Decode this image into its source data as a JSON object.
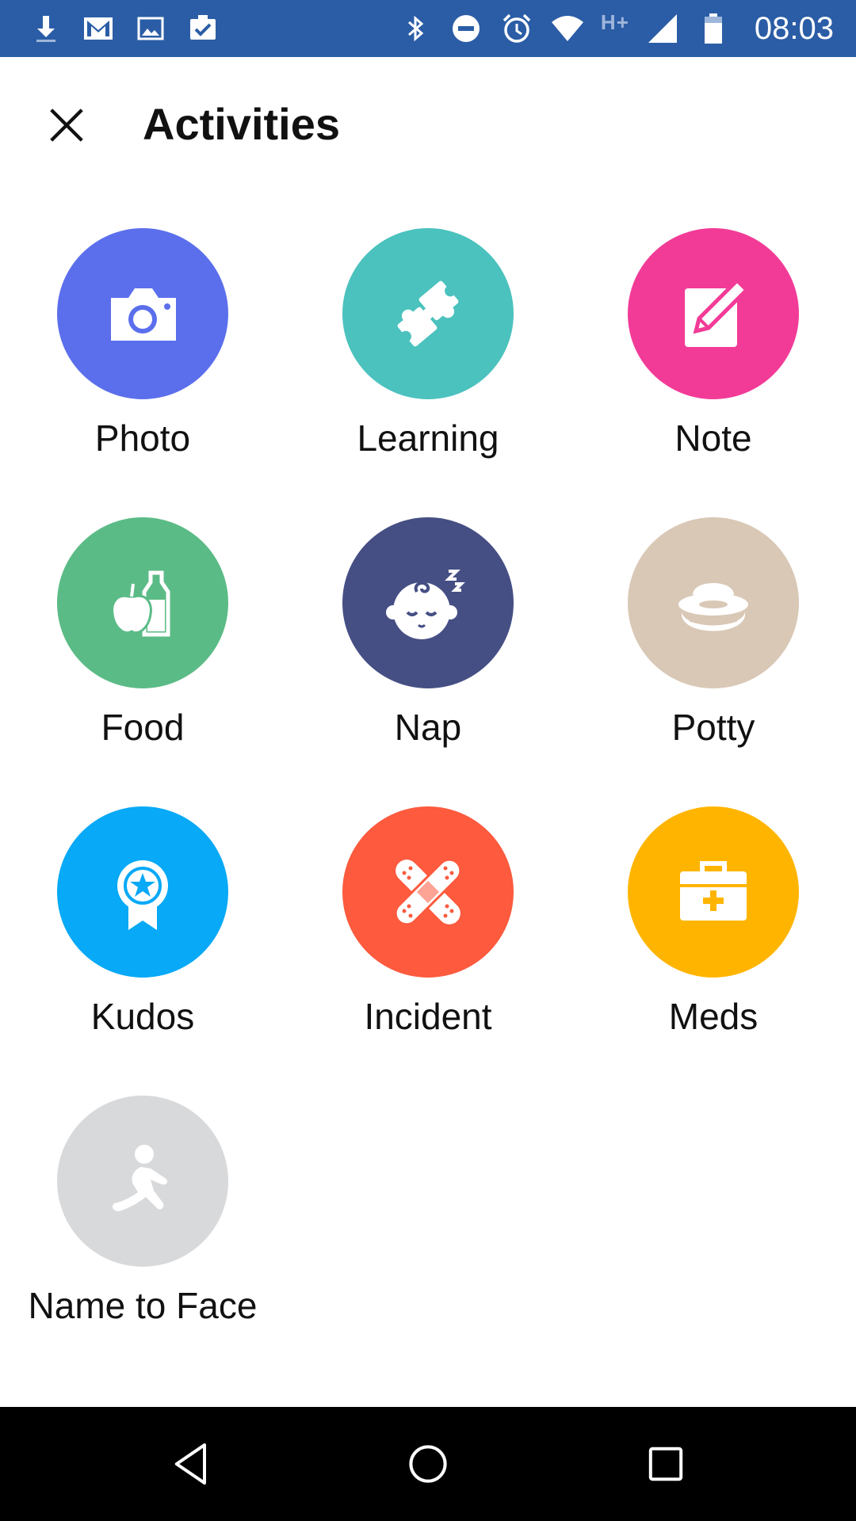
{
  "status_bar": {
    "time": "08:03",
    "network": "H+",
    "background": "#2b5da6",
    "left_icons": [
      "download-icon",
      "gmail-icon",
      "image-icon",
      "clipboard-check-icon"
    ],
    "right_icons": [
      "bluetooth-icon",
      "do-not-disturb-icon",
      "alarm-icon",
      "wifi-icon",
      "cell-signal-icon",
      "battery-icon"
    ]
  },
  "header": {
    "title": "Activities",
    "close_icon": "close-icon"
  },
  "activities": [
    {
      "label": "Photo",
      "color": "#5b6fec",
      "icon": "camera-icon"
    },
    {
      "label": "Learning",
      "color": "#4bc2be",
      "icon": "puzzle-icon"
    },
    {
      "label": "Note",
      "color": "#f23b97",
      "icon": "note-pencil-icon"
    },
    {
      "label": "Food",
      "color": "#5bbb86",
      "icon": "apple-bottle-icon"
    },
    {
      "label": "Nap",
      "color": "#454f84",
      "icon": "sleeping-baby-icon"
    },
    {
      "label": "Potty",
      "color": "#d9c8b6",
      "icon": "potty-icon"
    },
    {
      "label": "Kudos",
      "color": "#08a9f6",
      "icon": "award-ribbon-icon"
    },
    {
      "label": "Incident",
      "color": "#fd5a3e",
      "icon": "bandage-icon"
    },
    {
      "label": "Meds",
      "color": "#ffb500",
      "icon": "medkit-icon"
    },
    {
      "label": "Name to Face",
      "color": "#d8d9db",
      "icon": "running-person-icon"
    }
  ],
  "nav_bar": {
    "buttons": [
      "back-icon",
      "home-icon",
      "recents-icon"
    ]
  }
}
